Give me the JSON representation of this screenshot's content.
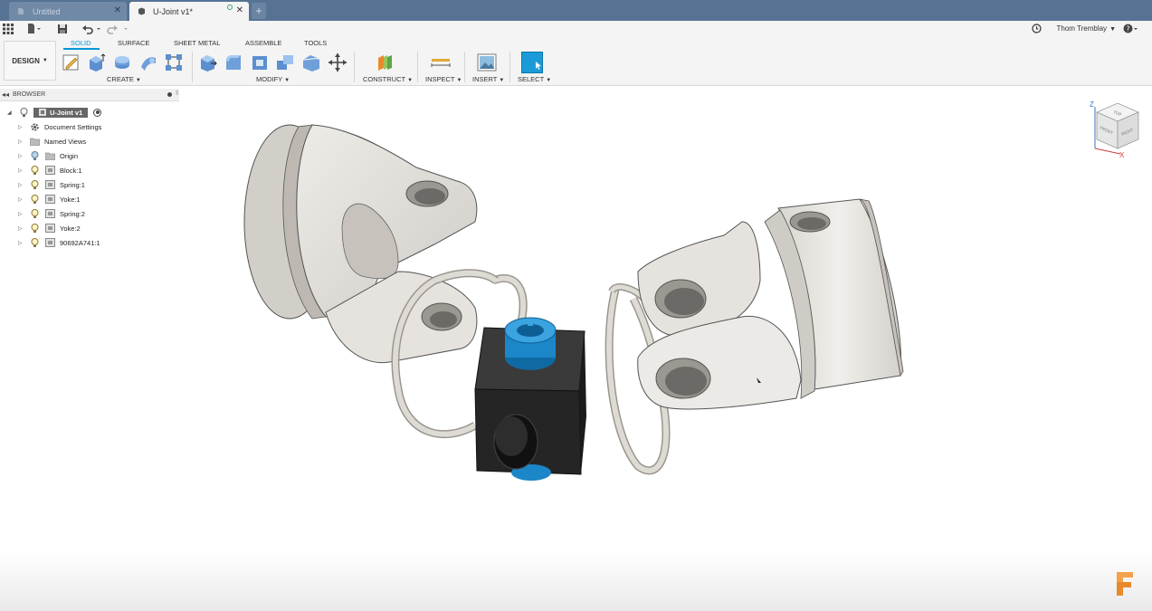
{
  "tabs": [
    {
      "label": "Untitled",
      "active": false
    },
    {
      "label": "U-Joint v1*",
      "active": true
    }
  ],
  "quick_access": {
    "user_name": "Thom Tremblay"
  },
  "workspace": {
    "label": "DESIGN"
  },
  "ribbon_tabs": [
    {
      "label": "SOLID",
      "active": true
    },
    {
      "label": "SURFACE",
      "active": false
    },
    {
      "label": "SHEET METAL",
      "active": false
    },
    {
      "label": "ASSEMBLE",
      "active": false
    },
    {
      "label": "TOOLS",
      "active": false
    }
  ],
  "tool_groups": {
    "create": "CREATE",
    "modify": "MODIFY",
    "construct": "CONSTRUCT",
    "inspect": "INSPECT",
    "insert": "INSERT",
    "select": "SELECT"
  },
  "browser": {
    "title": "BROWSER",
    "root": "U-Joint v1",
    "items": [
      {
        "label": "Document Settings",
        "icon": "gear-icon"
      },
      {
        "label": "Named Views",
        "icon": "folder-icon"
      },
      {
        "label": "Origin",
        "icon": "folder-icon"
      },
      {
        "label": "Block:1",
        "icon": "component-icon"
      },
      {
        "label": "Spring:1",
        "icon": "component-icon"
      },
      {
        "label": "Yoke:1",
        "icon": "component-icon"
      },
      {
        "label": "Spring:2",
        "icon": "component-icon"
      },
      {
        "label": "Yoke:2",
        "icon": "component-icon"
      },
      {
        "label": "90692A741:1",
        "icon": "component-icon"
      }
    ]
  },
  "viewcube": {
    "top": "TOP",
    "front": "FRONT",
    "right": "RIGHT",
    "axis_z": "Z",
    "axis_x": "X"
  },
  "colors": {
    "tabbar": "#567394",
    "accent": "#0696d7",
    "part_gray": "#e4e1dc",
    "block_black": "#2a2a2a",
    "bushing_blue": "#1b86c8",
    "fusion_orange": "#e88a2c"
  }
}
